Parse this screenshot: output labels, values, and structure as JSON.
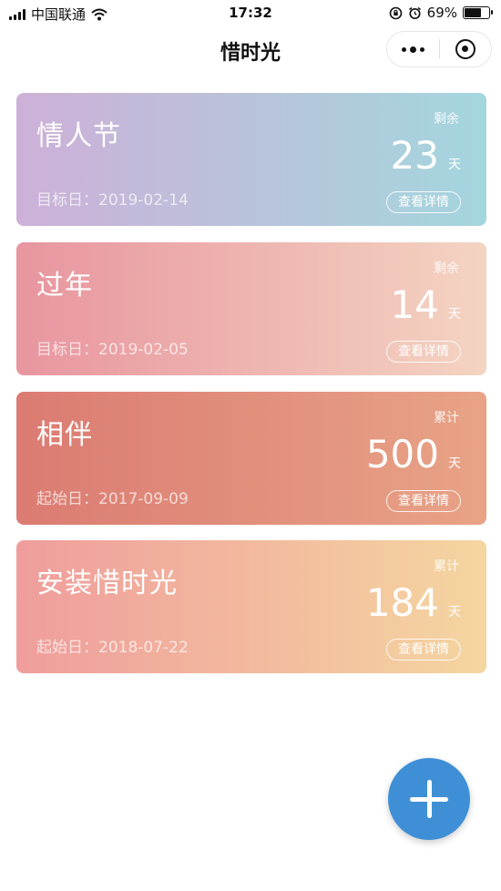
{
  "status_bar": {
    "carrier": "中国联通",
    "time": "17:32",
    "battery_percent": "69%",
    "battery_level": 0.69
  },
  "nav": {
    "title": "惜时光"
  },
  "cards": [
    {
      "title": "情人节",
      "kind": "剩余",
      "count": "23",
      "unit": "天",
      "date_label": "目标日：",
      "date": "2019-02-14",
      "detail": "查看详情",
      "gradient": [
        "#cdb0d8",
        "#a4d6de"
      ]
    },
    {
      "title": "过年",
      "kind": "剩余",
      "count": "14",
      "unit": "天",
      "date_label": "目标日：",
      "date": "2019-02-05",
      "detail": "查看详情",
      "gradient": [
        "#e8959f",
        "#f4d4c2"
      ]
    },
    {
      "title": "相伴",
      "kind": "累计",
      "count": "500",
      "unit": "天",
      "date_label": "起始日：",
      "date": "2017-09-09",
      "detail": "查看详情",
      "gradient": [
        "#db7b72",
        "#e8a386"
      ]
    },
    {
      "title": "安装惜时光",
      "kind": "累计",
      "count": "184",
      "unit": "天",
      "date_label": "起始日：",
      "date": "2018-07-22",
      "detail": "查看详情",
      "gradient": [
        "#ef9d9c",
        "#f5d6a0"
      ]
    }
  ],
  "fab": {
    "icon": "plus-icon",
    "color": "#3f8fd6"
  }
}
